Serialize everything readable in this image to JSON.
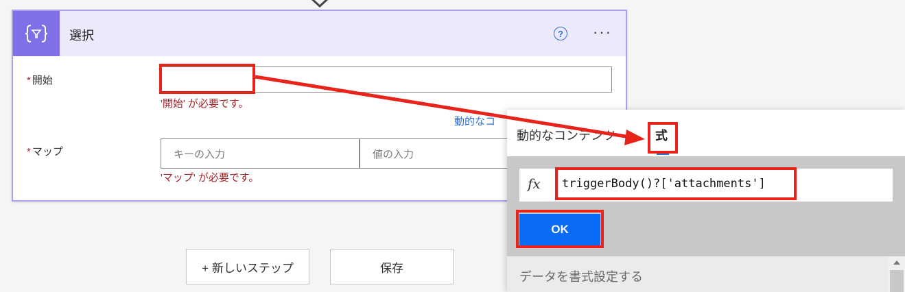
{
  "card": {
    "title": "選択",
    "icon": "select-data-operation-icon",
    "help_icon": "help-icon",
    "help_glyph": "?",
    "more_icon": "more-options-icon",
    "more_glyph": "···"
  },
  "fields": {
    "required_mark": "*",
    "start_label": "開始",
    "start_error": "'開始' が必要です。",
    "dynamic_link": "動的なコ",
    "map_label": "マップ",
    "map_key_placeholder": "キーの入力",
    "map_value_placeholder": "値の入力",
    "map_error": "'マップ' が必要です。"
  },
  "footer": {
    "new_step_label": "+ 新しいステップ",
    "save_label": "保存"
  },
  "panel": {
    "tab_dynamic": "動的なコンテンツ",
    "tab_expression": "式",
    "fx_label": "fx",
    "expression_value": "triggerBody()?['attachments']",
    "ok_label": "OK",
    "format_section_label": "データを書式設定する"
  },
  "colors": {
    "accent_purple": "#7f70e8",
    "header_bg": "#ece9fb",
    "error_red": "#a4262c",
    "link_blue": "#2b6fd6",
    "ok_blue": "#0a6cf5",
    "annotation_red": "#e8231a"
  }
}
